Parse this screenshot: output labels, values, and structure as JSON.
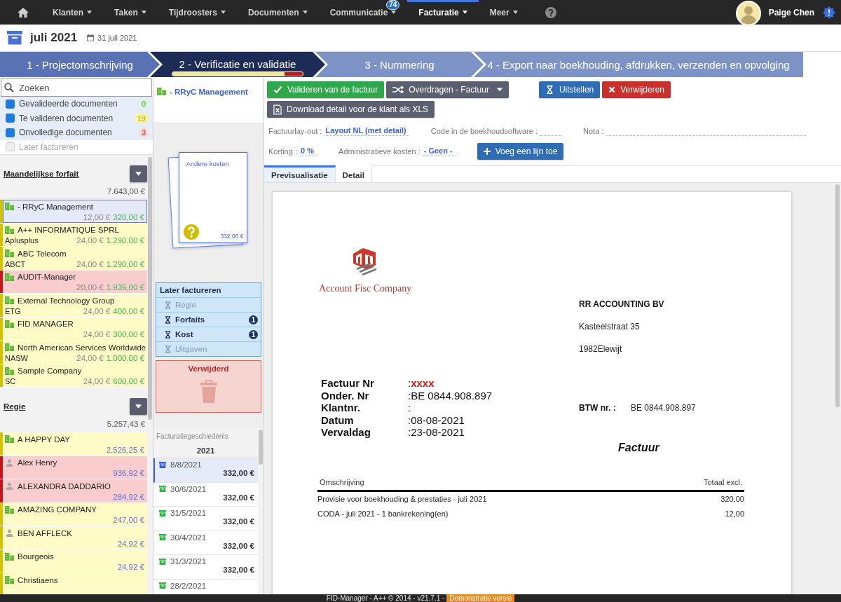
{
  "nav": {
    "items": [
      {
        "label": "Klanten",
        "selected": false
      },
      {
        "label": "Taken",
        "selected": false
      },
      {
        "label": "Tijdroosters",
        "selected": false
      },
      {
        "label": "Documenten",
        "selected": false
      },
      {
        "label": "Communicatie",
        "selected": false,
        "badge": "74"
      },
      {
        "label": "Facturatie",
        "selected": true
      },
      {
        "label": "Meer",
        "selected": false
      }
    ],
    "user": {
      "name": "Paige Chen"
    }
  },
  "header": {
    "title": "juli 2021",
    "date": "31 juli 2021"
  },
  "steps": [
    {
      "label": "1 - Projectomschrijving",
      "selected": false,
      "done": true
    },
    {
      "label": "2 - Verificatie en validatie",
      "selected": true,
      "done": false,
      "progress": {
        "level": 0.86
      }
    },
    {
      "label": "3 - Nummering",
      "selected": false,
      "done": false
    },
    {
      "label": "4 - Export naar boekhouding, afdrukken, verzenden en opvolging",
      "selected": false,
      "done": false
    }
  ],
  "sidebar": {
    "search": {
      "placeholder": "Zoeken"
    },
    "filters": [
      {
        "label": "Gevalideerde documenten",
        "checked": true,
        "disabled": false,
        "count": "0",
        "color": "#ddf3dd"
      },
      {
        "label": "Te valideren documenten",
        "checked": true,
        "disabled": false,
        "count": "19",
        "color": "#fdf39a"
      },
      {
        "label": "Onvolledige documenten",
        "checked": true,
        "disabled": false,
        "count": "3",
        "color": "#fbdada"
      },
      {
        "label": "Later factureren",
        "checked": false,
        "disabled": true
      }
    ],
    "groups": [
      {
        "title": "Maandelijkse forfait",
        "kind": "forfait",
        "total": "7.643,00 €",
        "items": [
          {
            "name": "- RRyC Management",
            "kind": "company",
            "color": "#d2c200",
            "selected": true,
            "cost": "12,00 €",
            "amount": "320,00 €"
          },
          {
            "name": "A++ INFORMATIQUE SPRL",
            "code": "Aplusplus",
            "kind": "company",
            "color": "#d2c200",
            "selected": false,
            "cost": "24,00 €",
            "amount": "1.290,00 €"
          },
          {
            "name": "ABC Telecom",
            "code": "ABCT",
            "kind": "company",
            "color": "#d2c200",
            "selected": false,
            "cost": "24,00 €",
            "amount": "1.290,00 €"
          },
          {
            "name": "AUDIT-Manager",
            "kind": "company",
            "color": "#c8161d",
            "selected": false,
            "cost": "20,00 €",
            "amount": "1.935,00 €"
          },
          {
            "name": "External Technology Group",
            "code": "ETG",
            "kind": "company",
            "color": "#d2c200",
            "selected": false,
            "cost": "24,00 €",
            "amount": "400,00 €"
          },
          {
            "name": "FID MANAGER",
            "kind": "company",
            "color": "#d2c200",
            "selected": false,
            "cost": "24,00 €",
            "amount": "300,00 €"
          },
          {
            "name": "North American Services Worldwide",
            "code": "NASW",
            "kind": "company",
            "color": "#d2c200",
            "selected": false,
            "cost": "24,00 €",
            "amount": "1.000,00 €"
          },
          {
            "name": "Sample Company",
            "code": "SC",
            "kind": "company",
            "color": "#d2c200",
            "selected": false,
            "cost": "24,00 €",
            "amount": "600,00 €"
          }
        ]
      },
      {
        "title": "Regie",
        "kind": "regie",
        "total": "5.257,43 €",
        "items": [
          {
            "name": "A HAPPY DAY",
            "kind": "company",
            "color": "#d2c200",
            "selected": false,
            "amount": "2.526,25 €"
          },
          {
            "name": "Alex Henry",
            "kind": "person",
            "color": "#c8161d",
            "selected": false,
            "amount": "936,92 €"
          },
          {
            "name": "ALEXANDRA DADDARIO",
            "kind": "person",
            "color": "#c8161d",
            "selected": false,
            "amount": "284,92 €"
          },
          {
            "name": "AMAZING COMPANY",
            "kind": "company",
            "color": "#d2c200",
            "selected": false,
            "amount": "247,00 €"
          },
          {
            "name": "BEN AFFLECK",
            "kind": "person",
            "color": "#d2c200",
            "selected": false,
            "amount": "24,92 €"
          },
          {
            "name": "Bourgeois",
            "kind": "company",
            "color": "#d2c200",
            "selected": false,
            "amount": "24,92 €"
          },
          {
            "name": "Christiaens",
            "kind": "company",
            "color": "#d2c200",
            "selected": false
          }
        ]
      }
    ]
  },
  "client_panel": {
    "client": "- RRyC Management",
    "document": {
      "title": "Andere kosten",
      "amount": "332,00 €"
    },
    "later": {
      "title": "Later factureren",
      "items": [
        {
          "label": "Regie",
          "disabled": true
        },
        {
          "label": "Forfaits",
          "disabled": false,
          "count": "1"
        },
        {
          "label": "Kost",
          "disabled": false,
          "count": "1"
        },
        {
          "label": "Uitgaven",
          "disabled": true
        }
      ]
    },
    "deleted": {
      "title": "Verwijderd"
    },
    "history": {
      "title": "Facturatiegeschiedenis",
      "year": "2021",
      "entries": [
        {
          "date": "8/8/2021",
          "amount": "332,00 €",
          "selected": true
        },
        {
          "date": "30/6/2021",
          "amount": "332,00 €",
          "selected": false
        },
        {
          "date": "31/5/2021",
          "amount": "332,00 €",
          "selected": false
        },
        {
          "date": "30/4/2021",
          "amount": "332,00 €",
          "selected": false
        },
        {
          "date": "31/3/2021",
          "amount": "332,00 €",
          "selected": false
        },
        {
          "date": "28/2/2021",
          "selected": false
        }
      ]
    }
  },
  "editor": {
    "toolbar": {
      "rows": [
        {
          "buttons": [
            {
              "label": "Valideren van de factuur",
              "kind": "validate"
            },
            {
              "label": "Overdragen - Factuur",
              "kind": "transfer"
            },
            {
              "label": "Uitstellen",
              "kind": "postpone"
            },
            {
              "label": "Verwijderen",
              "kind": "delete"
            }
          ]
        },
        {
          "buttons": [
            {
              "label": "Download detail voor de klant als XLS",
              "kind": "download"
            }
          ]
        }
      ]
    },
    "form": {
      "rows": [
        {
          "fields": [
            {
              "label": "Factuurlay-out :",
              "value": "Layout NL (met detail)"
            },
            {
              "label": "Code in de boekhoudsoftware :"
            },
            {
              "label": "Nota :"
            }
          ]
        },
        {
          "fields": [
            {
              "label": "Korting :",
              "value": "0 %"
            },
            {
              "label": "Administratieve kosten :",
              "value": "- Geen -"
            }
          ],
          "button": {
            "label": "Voeg een lijn toe",
            "kind": "add"
          }
        }
      ]
    },
    "tabs": [
      {
        "label": "Previsualisatie",
        "selected": true
      },
      {
        "label": "Detail",
        "selected": false
      }
    ],
    "invoice": {
      "company": "Account Fisc Company",
      "recipient": {
        "name": "RR ACCOUNTING BV",
        "street": "Kasteelstraat 35",
        "city": "1982Elewijt"
      },
      "meta": [
        {
          "label": "Factuur Nr",
          "sep": ":",
          "value": "xxxx",
          "alert": true
        },
        {
          "label": "Onder. Nr",
          "sep": ":",
          "value": "BE 0844.908.897",
          "alert": false
        },
        {
          "label": "Klantnr.",
          "sep": ":"
        },
        {
          "label": "Datum",
          "sep": ":",
          "value": "08-08-2021",
          "alert": false
        },
        {
          "label": "Vervaldag",
          "sep": ":",
          "value": "23-08-2021",
          "alert": false
        }
      ],
      "vat": {
        "label": "BTW nr. :",
        "value": "BE 0844.908.897"
      },
      "title": "Factuur",
      "columns": [
        "Omschrijving",
        "Totaal excl."
      ],
      "lines": [
        {
          "description": "Provisie voor boekhouding & prestaties - juli 2021",
          "total": "320,00"
        },
        {
          "description": "CODA - juli 2021 - 1 bankrekening(en)",
          "total": "12,00"
        }
      ]
    }
  },
  "footer": {
    "text": "FID-Manager - A++ © 2014 - v21.7.1 -",
    "badge": "Demonstratie versie"
  }
}
